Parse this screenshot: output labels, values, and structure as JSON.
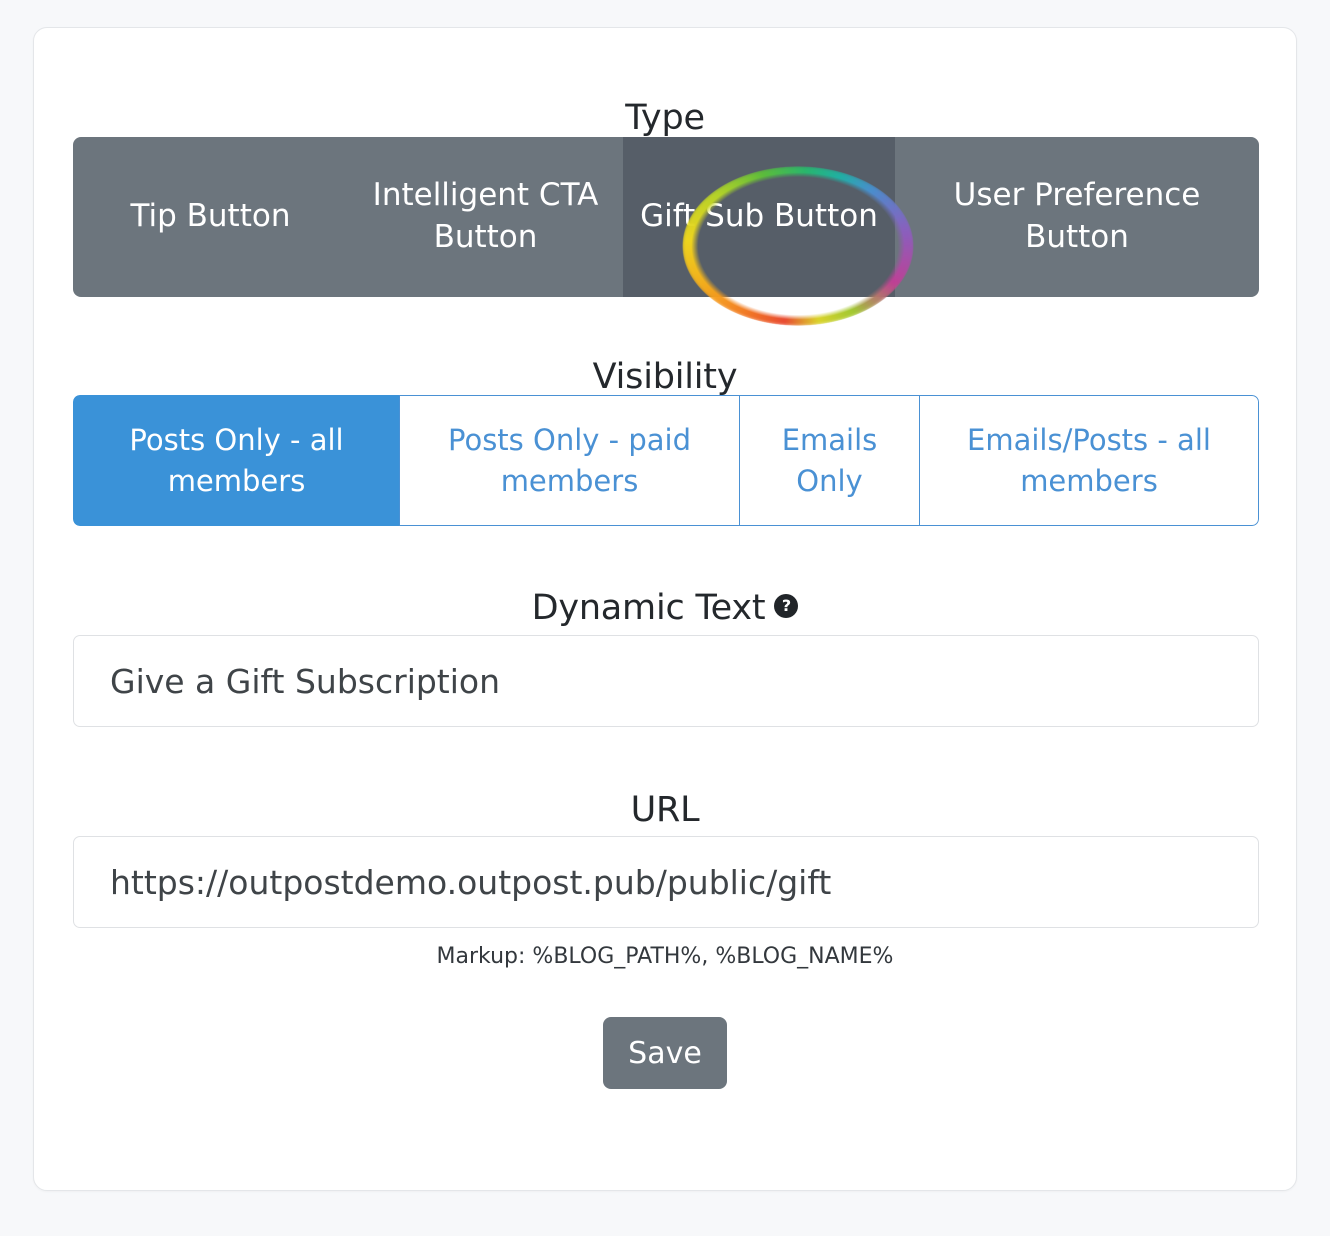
{
  "type_section": {
    "label": "Type",
    "options": [
      {
        "label": "Tip Button",
        "selected": false
      },
      {
        "label": "Intelligent CTA Button",
        "selected": false
      },
      {
        "label": "Gift Sub Button",
        "selected": true
      },
      {
        "label": "User Preference Button",
        "selected": false
      }
    ],
    "selected": "Gift Sub Button",
    "colors": {
      "inactive_bg": "#6c757d",
      "active_bg": "#565e68",
      "text": "#ffffff"
    },
    "highlight": {
      "shape": "ellipse-ring",
      "target": "Gift Sub Button",
      "style": "rainbow"
    }
  },
  "visibility_section": {
    "label": "Visibility",
    "options": [
      {
        "label": "Posts Only - all members",
        "selected": true
      },
      {
        "label": "Posts Only - paid members",
        "selected": false
      },
      {
        "label": "Emails Only",
        "selected": false
      },
      {
        "label": "Emails/Posts - all members",
        "selected": false
      }
    ],
    "selected": "Posts Only - all members",
    "colors": {
      "accent": "#3a92d8",
      "inactive_text": "#4a91d4",
      "active_text": "#ffffff"
    }
  },
  "dynamic_text_section": {
    "label": "Dynamic Text",
    "help_icon": "question-mark-circle-icon",
    "value": "Give a Gift Subscription",
    "placeholder": "Give a Gift Subscription"
  },
  "url_section": {
    "label": "URL",
    "value": "https://outpostdemo.outpost.pub/public/gift",
    "placeholder": "https://outpostdemo.outpost.pub/public/gift",
    "hint": "Markup: %BLOG_PATH%, %BLOG_NAME%"
  },
  "actions": {
    "save_label": "Save",
    "save_color": "#6c757d"
  }
}
